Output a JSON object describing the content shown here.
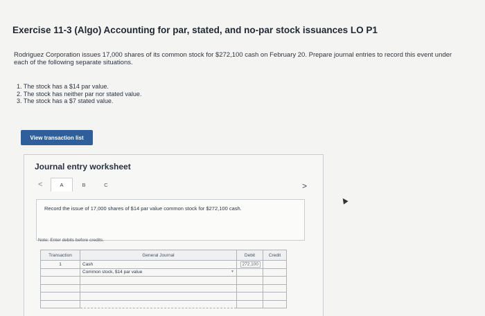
{
  "exercise": {
    "title": "Exercise 11-3 (Algo) Accounting for par, stated, and no-par stock issuances LO P1",
    "intro": "Rodriguez Corporation issues 17,000 shares of its common stock for $272,100 cash on February 20. Prepare journal entries to record this event under each of the following separate situations.",
    "situations": [
      "1. The stock has a $14 par value.",
      "2. The stock has neither par nor stated value.",
      "3. The stock has a $7 stated value."
    ]
  },
  "toolbar": {
    "view_transaction_label": "View transaction list"
  },
  "worksheet": {
    "title": "Journal entry worksheet",
    "tab_prev": "<",
    "tab_next": ">",
    "tabs": [
      "A",
      "B",
      "C"
    ],
    "active_tab": "A",
    "instruction": "Record the issue of 17,000 shares of $14 par value common stock for $272,100 cash.",
    "note": "Note: Enter debits before credits.",
    "table": {
      "headers": {
        "transaction": "Transaction",
        "journal": "General Journal",
        "debit": "Debit",
        "credit": "Credit"
      },
      "rows": [
        {
          "transaction": "1",
          "account": "Cash",
          "debit": "272,100",
          "credit": ""
        },
        {
          "transaction": "",
          "account": "Common stock, $14 par value",
          "debit": "",
          "credit": ""
        },
        {
          "transaction": "",
          "account": "",
          "debit": "",
          "credit": ""
        },
        {
          "transaction": "",
          "account": "",
          "debit": "",
          "credit": ""
        },
        {
          "transaction": "",
          "account": "",
          "debit": "",
          "credit": ""
        },
        {
          "transaction": "",
          "account": "",
          "debit": "",
          "credit": ""
        }
      ]
    }
  },
  "colors": {
    "button": "#2f5f9a",
    "link_dashed": "#8fb0d0"
  }
}
